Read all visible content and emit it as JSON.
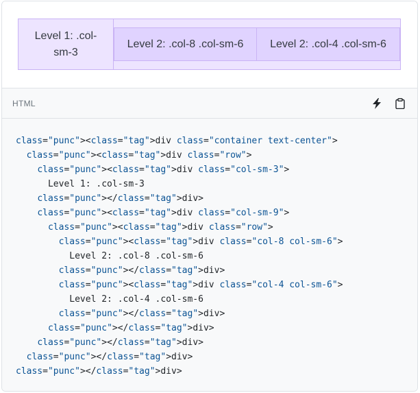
{
  "preview": {
    "level1": "Level 1: .col-sm-3",
    "level2a": "Level 2: .col-8 .col-sm-6",
    "level2b": "Level 2: .col-4 .col-sm-6"
  },
  "code_header": {
    "language": "HTML",
    "icons": [
      "lightning-icon",
      "clipboard-icon"
    ]
  },
  "code": {
    "lines": [
      "<div class=\"container text-center\">",
      "  <div class=\"row\">",
      "    <div class=\"col-sm-3\">",
      "      Level 1: .col-sm-3",
      "    </div>",
      "    <div class=\"col-sm-9\">",
      "      <div class=\"row\">",
      "        <div class=\"col-8 col-sm-6\">",
      "          Level 2: .col-8 .col-sm-6",
      "        </div>",
      "        <div class=\"col-4 col-sm-6\">",
      "          Level 2: .col-4 .col-sm-6",
      "        </div>",
      "      </div>",
      "    </div>",
      "  </div>",
      "</div>"
    ]
  }
}
